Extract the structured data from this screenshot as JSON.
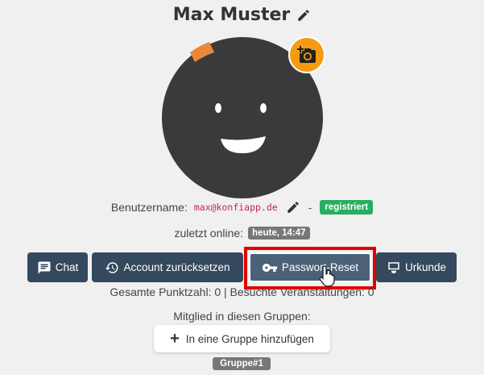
{
  "profile": {
    "name": "Max Muster"
  },
  "account": {
    "username_label": "Benutzername:",
    "username": "max@konfiapp.de",
    "separator": "-",
    "status_badge": "registriert",
    "online_label": "zuletzt online:",
    "online_value": "heute, 14:47"
  },
  "actions": {
    "chat": "Chat",
    "reset_account": "Account zurücksetzen",
    "password_reset": "Passwort-Reset",
    "certificate": "Urkunde"
  },
  "stats": {
    "summary": "Gesamte Punktzahl: 0 | Besuchte Veranstaltungen: 0"
  },
  "groups": {
    "label": "Mitglied in diesen Gruppen:",
    "add_button": "In eine Gruppe hinzufügen",
    "items": [
      "Gruppe#1"
    ]
  },
  "colors": {
    "primary_button": "#34495e",
    "camera_button": "#f39c12",
    "status_green": "#27ae60",
    "highlight": "#e00000"
  },
  "icons": {
    "title_edit": "pencil-icon",
    "camera": "add-photo-icon",
    "username_edit": "pencil-icon",
    "chat": "chat-icon",
    "reset": "history-icon",
    "password": "key-icon",
    "certificate": "certificate-icon"
  }
}
